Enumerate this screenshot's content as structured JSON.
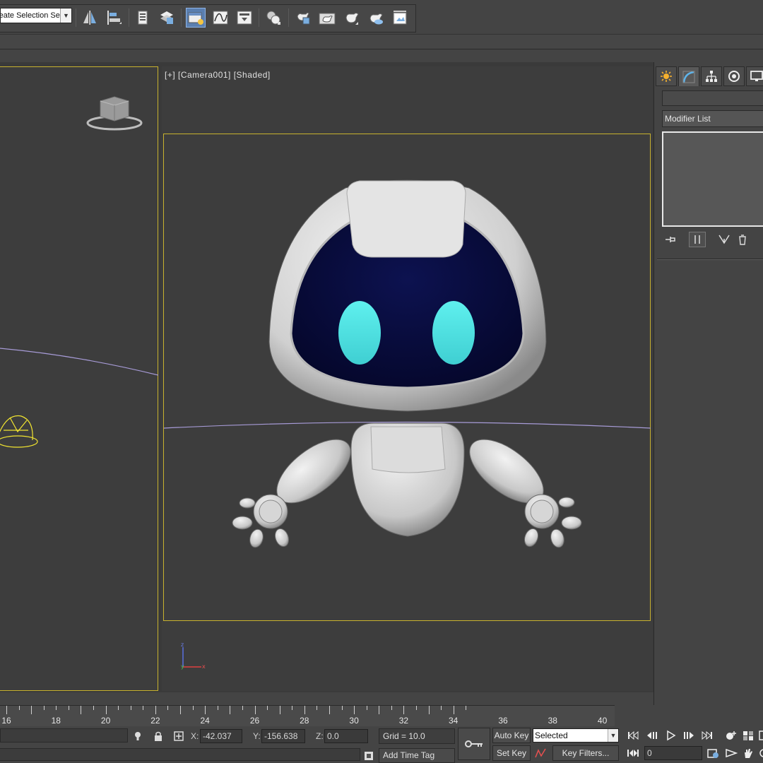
{
  "toolbar": {
    "selection_set_placeholder": "Create Selection Se"
  },
  "viewport": {
    "label": "[+] [Camera001] [Shaded]",
    "gizmo_axes": {
      "x": "x",
      "y": "y",
      "z": "z"
    }
  },
  "command_panel": {
    "tabs": [
      "create-icon",
      "modify-icon",
      "hierarchy-icon",
      "motion-icon",
      "display-icon"
    ],
    "object_name": "",
    "modifier_list_label": "Modifier List"
  },
  "time_ruler": {
    "labels": [
      "16",
      "18",
      "20",
      "22",
      "24",
      "26",
      "28",
      "30",
      "32",
      "34",
      "36",
      "38",
      "40"
    ]
  },
  "status": {
    "x_label": "X:",
    "x_value": "-42.037",
    "y_label": "Y:",
    "y_value": "-156.638",
    "z_label": "Z:",
    "z_value": "0.0",
    "grid": "Grid = 10.0",
    "add_time_tag": "Add Time Tag",
    "auto_key": "Auto Key",
    "set_key": "Set Key",
    "selected": "Selected",
    "key_filters": "Key Filters...",
    "current_frame": "0"
  },
  "colors": {
    "viewport_border": "#c8b22e",
    "active_button": "#5a7fb0",
    "robot_visor": "#07093a",
    "robot_eyes": "#4fe3e3"
  }
}
